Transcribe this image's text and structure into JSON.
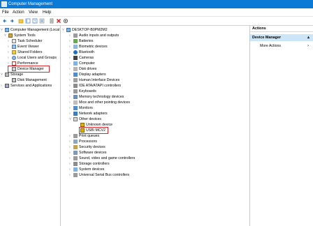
{
  "window": {
    "title": "Computer Management"
  },
  "menu": [
    "File",
    "Action",
    "View",
    "Help"
  ],
  "toolbar": [
    "back-icon",
    "forward-icon",
    "up-icon",
    "show-hide-icon",
    "help-icon",
    "properties-icon",
    "update-driver-icon",
    "delete-icon",
    "scan-icon"
  ],
  "left_tree": [
    {
      "label": "Computer Management (Local",
      "depth": 0,
      "expander": "v",
      "icon": "computer-icon"
    },
    {
      "label": "System Tools",
      "depth": 1,
      "expander": "v",
      "icon": "tools-icon"
    },
    {
      "label": "Task Scheduler",
      "depth": 2,
      "expander": ">",
      "icon": "clock-icon"
    },
    {
      "label": "Event Viewer",
      "depth": 2,
      "expander": ">",
      "icon": "event-icon"
    },
    {
      "label": "Shared Folders",
      "depth": 2,
      "expander": ">",
      "icon": "folder-icon"
    },
    {
      "label": "Local Users and Groups",
      "depth": 2,
      "expander": ">",
      "icon": "users-icon"
    },
    {
      "label": "Performance",
      "depth": 2,
      "expander": ">",
      "icon": "perf-icon"
    },
    {
      "label": "Device Manager",
      "depth": 2,
      "expander": "",
      "icon": "device-manager-icon",
      "highlighted": true
    },
    {
      "label": "Storage",
      "depth": 1,
      "expander": "v",
      "icon": "storage-icon"
    },
    {
      "label": "Disk Management",
      "depth": 2,
      "expander": "",
      "icon": "disk-icon"
    },
    {
      "label": "Services and Applications",
      "depth": 1,
      "expander": ">",
      "icon": "services-icon"
    }
  ],
  "device_tree": {
    "root": "DESKTOP-B0PM2M2",
    "items": [
      {
        "label": "Audio inputs and outputs",
        "expander": ">",
        "icon": "audio-icon"
      },
      {
        "label": "Batteries",
        "expander": ">",
        "icon": "battery-icon"
      },
      {
        "label": "Biometric devices",
        "expander": ">",
        "icon": "biometric-icon"
      },
      {
        "label": "Bluetooth",
        "expander": ">",
        "icon": "bluetooth-icon"
      },
      {
        "label": "Cameras",
        "expander": ">",
        "icon": "camera-icon"
      },
      {
        "label": "Computer",
        "expander": ">",
        "icon": "computer-icon"
      },
      {
        "label": "Disk drives",
        "expander": ">",
        "icon": "disk-icon"
      },
      {
        "label": "Display adapters",
        "expander": ">",
        "icon": "display-icon"
      },
      {
        "label": "Human Interface Devices",
        "expander": ">",
        "icon": "hid-icon"
      },
      {
        "label": "IDE ATA/ATAPI controllers",
        "expander": ">",
        "icon": "ide-icon"
      },
      {
        "label": "Keyboards",
        "expander": ">",
        "icon": "keyboard-icon"
      },
      {
        "label": "Memory technology devices",
        "expander": ">",
        "icon": "memory-icon"
      },
      {
        "label": "Mice and other pointing devices",
        "expander": ">",
        "icon": "mouse-icon"
      },
      {
        "label": "Monitors",
        "expander": ">",
        "icon": "monitor-icon"
      },
      {
        "label": "Network adapters",
        "expander": ">",
        "icon": "network-icon"
      },
      {
        "label": "Other devices",
        "expander": "v",
        "icon": "other-devices-icon"
      },
      {
        "label": "Unknown device",
        "expander": "",
        "icon": "unknown-device-icon",
        "child": true
      },
      {
        "label": "USB\\ MCV2",
        "expander": "",
        "icon": "unknown-device-icon",
        "child": true,
        "highlighted": true
      },
      {
        "label": "Print queues",
        "expander": ">",
        "icon": "printer-icon"
      },
      {
        "label": "Processors",
        "expander": ">",
        "icon": "cpu-icon"
      },
      {
        "label": "Security devices",
        "expander": ">",
        "icon": "security-icon"
      },
      {
        "label": "Software devices",
        "expander": ">",
        "icon": "software-icon"
      },
      {
        "label": "Sound, video and game controllers",
        "expander": ">",
        "icon": "sound-icon"
      },
      {
        "label": "Storage controllers",
        "expander": ">",
        "icon": "storage-icon"
      },
      {
        "label": "System devices",
        "expander": ">",
        "icon": "system-icon"
      },
      {
        "label": "Universal Serial Bus controllers",
        "expander": ">",
        "icon": "usb-icon"
      }
    ]
  },
  "actions": {
    "header": "Actions",
    "selected": "Device Manager",
    "more": "More Actions"
  },
  "colors": {
    "titlebar": "#0a7ad6",
    "selection": "#cde6f7",
    "highlight_box": "#e0262b"
  }
}
